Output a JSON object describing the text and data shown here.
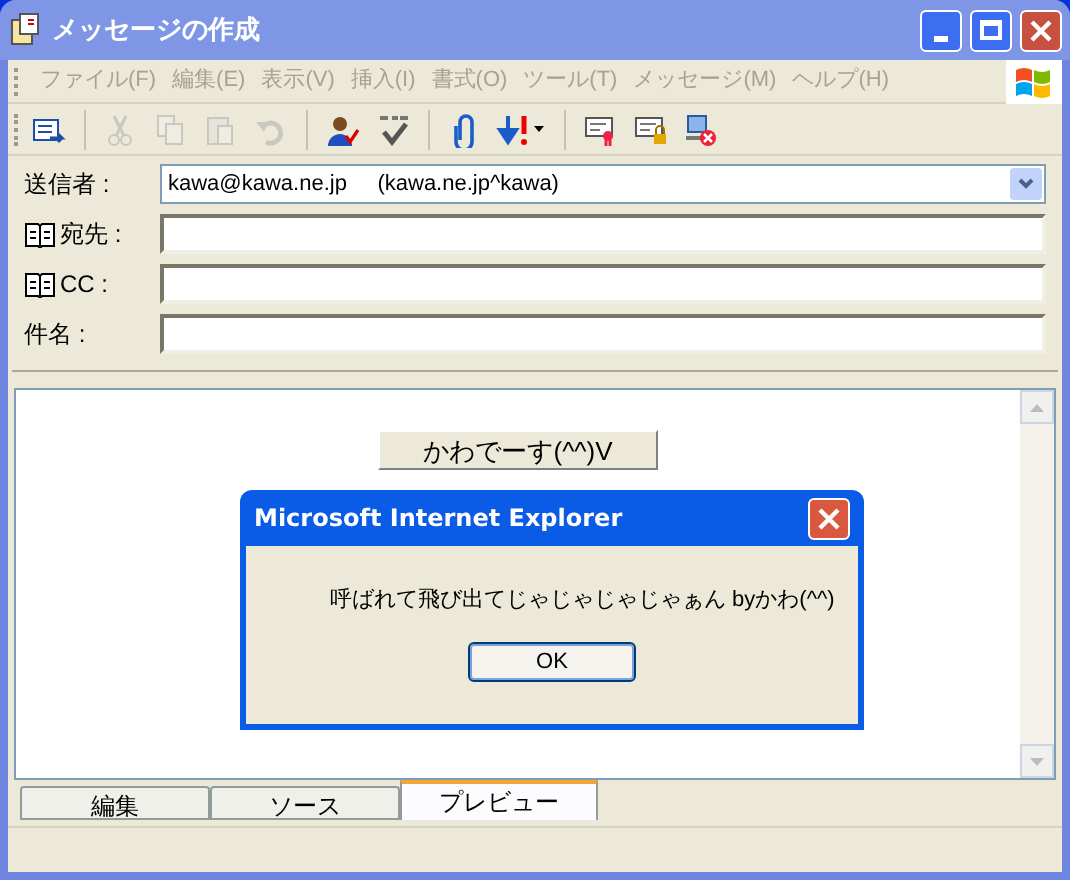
{
  "window": {
    "title": "メッセージの作成"
  },
  "menu": [
    {
      "label": "ファイル(F)",
      "disabled": true
    },
    {
      "label": "編集(E)",
      "disabled": true
    },
    {
      "label": "表示(V)",
      "disabled": true
    },
    {
      "label": "挿入(I)",
      "disabled": true
    },
    {
      "label": "書式(O)",
      "disabled": true
    },
    {
      "label": "ツール(T)",
      "disabled": true
    },
    {
      "label": "メッセージ(M)",
      "disabled": true
    },
    {
      "label": "ヘルプ(H)",
      "disabled": true
    }
  ],
  "toolbar": [
    {
      "kind": "send",
      "disabled": false
    },
    {
      "kind": "separator"
    },
    {
      "kind": "cut",
      "disabled": true
    },
    {
      "kind": "copy",
      "disabled": true
    },
    {
      "kind": "paste",
      "disabled": true
    },
    {
      "kind": "undo",
      "disabled": true
    },
    {
      "kind": "separator"
    },
    {
      "kind": "check-names",
      "disabled": false
    },
    {
      "kind": "spelling",
      "disabled": false
    },
    {
      "kind": "separator"
    },
    {
      "kind": "attach",
      "disabled": false
    },
    {
      "kind": "priority",
      "disabled": false
    },
    {
      "kind": "separator"
    },
    {
      "kind": "sign",
      "disabled": false
    },
    {
      "kind": "encrypt",
      "disabled": false
    },
    {
      "kind": "offline",
      "disabled": false
    }
  ],
  "fields": [
    {
      "kind": "select",
      "label": "送信者 :",
      "value": "kawa@kawa.ne.jp     (kawa.ne.jp^kawa)"
    },
    {
      "kind": "book",
      "label": "宛先 :"
    },
    {
      "kind": "book",
      "label": "CC :"
    },
    {
      "kind": "plain",
      "label": "件名 :"
    }
  ],
  "body": {
    "button": "かわでーす(^^)V"
  },
  "dialog": {
    "title": "Microsoft Internet Explorer",
    "message": "呼ばれて飛び出てじゃじゃじゃじゃぁん byかわ(^^)",
    "button": "OK"
  },
  "tabs": [
    {
      "label": "編集",
      "selected": false
    },
    {
      "label": "ソース",
      "selected": false
    },
    {
      "label": "プレビュー",
      "selected": true
    }
  ]
}
